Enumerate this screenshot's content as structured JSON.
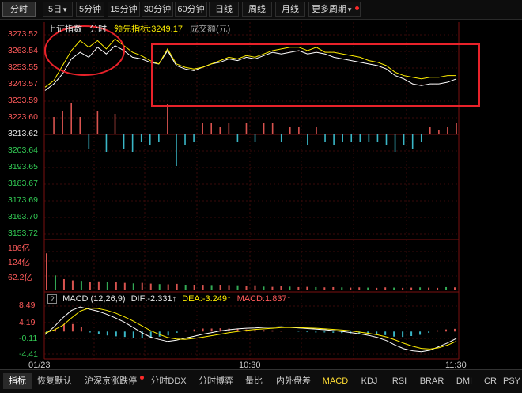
{
  "top_tabs": [
    {
      "label": "分时",
      "active": true
    },
    {
      "label": "5日",
      "dropdown": true
    },
    {
      "label": "5分钟"
    },
    {
      "label": "15分钟"
    },
    {
      "label": "30分钟"
    },
    {
      "label": "60分钟"
    },
    {
      "label": "日线"
    },
    {
      "label": "周线"
    },
    {
      "label": "月线"
    },
    {
      "label": "更多周期",
      "dropdown": true,
      "dot": true
    }
  ],
  "main_legend": {
    "index_name": "上证指数",
    "mode": "分时",
    "leading_label": "领先指标:",
    "leading_value": "3249.17",
    "volume_label": "成交额(元)"
  },
  "price_axis": [
    "3273.52",
    "3263.54",
    "3253.55",
    "3243.57",
    "3233.59",
    "3223.60",
    "3213.62",
    "3203.64",
    "3193.65",
    "3183.67",
    "3173.69",
    "3163.70",
    "3153.72"
  ],
  "volume_axis": [
    "186亿",
    "124亿",
    "62.2亿"
  ],
  "macd_legend": {
    "help": "?",
    "title": "MACD (12,26,9)",
    "dif": "DIF:-2.331↑",
    "dea": "DEA:-3.249↑",
    "macd": "MACD:1.837↑"
  },
  "macd_axis": [
    "8.49",
    "4.19",
    "-0.11",
    "-4.41"
  ],
  "time_axis": [
    "01/23",
    "10:30",
    "11:30"
  ],
  "bottom_tabs": [
    {
      "label": "指标",
      "active": true
    },
    {
      "label": "恢复默认"
    },
    {
      "label": "沪深京涨跌停",
      "dot": true
    },
    {
      "label": "分时DDX"
    },
    {
      "label": "分时博弈"
    },
    {
      "label": "量比"
    },
    {
      "label": "内外盘差"
    },
    {
      "label": "MACD",
      "highlight": true
    },
    {
      "label": "KDJ"
    },
    {
      "label": "RSI"
    },
    {
      "label": "BRAR"
    },
    {
      "label": "DMI"
    },
    {
      "label": "CR"
    },
    {
      "label": "PSY"
    }
  ],
  "chart_data": [
    {
      "type": "line",
      "title": "上证指数 分时",
      "ylim": [
        3153.72,
        3273.52
      ],
      "series": [
        {
          "name": "上证指数",
          "color": "#ffffff",
          "values": [
            3240,
            3244,
            3250,
            3259,
            3263,
            3260,
            3266,
            3262,
            3267,
            3264,
            3260,
            3259,
            3257,
            3256,
            3264,
            3255,
            3253,
            3252,
            3254,
            3256,
            3257,
            3259,
            3258,
            3260,
            3259,
            3261,
            3263,
            3262,
            3263,
            3264,
            3262,
            3263,
            3262,
            3260,
            3259,
            3258,
            3257,
            3256,
            3255,
            3253,
            3249,
            3247,
            3244,
            3243,
            3244,
            3244,
            3245,
            3247
          ]
        },
        {
          "name": "领先指标",
          "color": "#ffee00",
          "values": [
            3242,
            3246,
            3255,
            3264,
            3270,
            3266,
            3270,
            3265,
            3271,
            3267,
            3263,
            3261,
            3258,
            3256,
            3265,
            3256,
            3254,
            3253,
            3254,
            3256,
            3258,
            3260,
            3259,
            3261,
            3260,
            3262,
            3264,
            3265,
            3266,
            3266,
            3264,
            3266,
            3263,
            3263,
            3262,
            3261,
            3260,
            3258,
            3257,
            3255,
            3251,
            3249,
            3248,
            3247,
            3248,
            3248,
            3249,
            3249
          ]
        }
      ],
      "ticks": {
        "0": 1,
        "0.47": 1,
        "0.98": 1
      }
    },
    {
      "type": "bar",
      "title": "成交额",
      "values": [
        150,
        60,
        45,
        40,
        38,
        35,
        36,
        34,
        32,
        30,
        28,
        30,
        27,
        25,
        24,
        26,
        22,
        20,
        19,
        18,
        20,
        18,
        17,
        16,
        17,
        15,
        14,
        16,
        15,
        13,
        14,
        13,
        12,
        13,
        12,
        11,
        12,
        11,
        10,
        12,
        11,
        10,
        11,
        12,
        11,
        10,
        13,
        12
      ]
    },
    {
      "type": "bar",
      "title": "MACD (12,26,9)",
      "ylim": [
        -8.6,
        8.49
      ],
      "series": [
        {
          "name": "DIF",
          "color": "#ffffff",
          "values": [
            -1.0,
            1.5,
            4.5,
            7.0,
            8.2,
            7.5,
            6.8,
            5.8,
            4.6,
            3.2,
            1.5,
            -0.3,
            -1.8,
            -2.6,
            -3.3,
            -2.9,
            -2.2,
            -1.6,
            -0.9,
            -0.4,
            0.2,
            0.6,
            0.9,
            1.1,
            1.2,
            1.4,
            1.5,
            1.6,
            1.4,
            1.2,
            1.0,
            0.8,
            0.6,
            0.3,
            0.0,
            -0.4,
            -0.8,
            -1.3,
            -2.0,
            -3.0,
            -4.5,
            -5.7,
            -6.4,
            -6.7,
            -6.2,
            -5.0,
            -3.8,
            -2.3
          ]
        },
        {
          "name": "DEA",
          "color": "#ffee00",
          "values": [
            -0.5,
            0.5,
            2.0,
            4.5,
            6.8,
            7.8,
            7.7,
            7.1,
            6.2,
            5.0,
            3.6,
            2.0,
            0.4,
            -0.9,
            -2.0,
            -2.5,
            -2.6,
            -2.3,
            -1.9,
            -1.4,
            -0.9,
            -0.4,
            0.0,
            0.4,
            0.7,
            0.9,
            1.1,
            1.3,
            1.4,
            1.3,
            1.2,
            1.1,
            0.9,
            0.7,
            0.5,
            0.2,
            -0.2,
            -0.6,
            -1.1,
            -1.8,
            -2.8,
            -3.9,
            -4.9,
            -5.6,
            -5.8,
            -5.4,
            -4.5,
            -3.2
          ]
        },
        {
          "name": "MACD",
          "values": [
            -0.5,
            1.0,
            2.5,
            2.5,
            1.4,
            -0.3,
            -0.9,
            -1.3,
            -1.6,
            -1.8,
            -2.1,
            -2.3,
            -2.2,
            -1.7,
            -1.3,
            -0.4,
            0.4,
            0.7,
            1.0,
            1.0,
            1.1,
            1.0,
            0.9,
            0.7,
            0.5,
            0.5,
            0.4,
            0.3,
            0.0,
            -0.1,
            -0.2,
            -0.3,
            -0.3,
            -0.4,
            -0.5,
            -0.6,
            -0.6,
            -0.7,
            -0.9,
            -1.2,
            -1.7,
            -1.8,
            -1.5,
            -1.1,
            -0.4,
            0.4,
            0.7,
            0.9
          ]
        }
      ]
    }
  ]
}
